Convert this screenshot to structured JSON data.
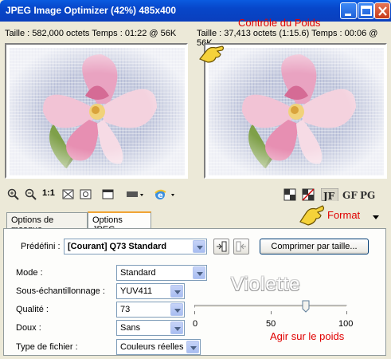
{
  "window": {
    "title": "JPEG Image Optimizer (42%) 485x400"
  },
  "info": {
    "left": "Taille : 582,000 octets Temps : 01:22 @ 56K",
    "right": "Taille : 37,413 octets (1:15.6) Temps : 00:06 @ 56K"
  },
  "annotations": {
    "weight_control": "Contrôle du Poids",
    "format": "Format",
    "act_on_weight": "Agir sur le poids",
    "watermark": "Violette"
  },
  "toolbar": {
    "zoom_reset_label": "1:1",
    "format_icons": [
      "jpeg-format-icon",
      "gif-format-icon",
      "png-format-icon"
    ]
  },
  "tabs": [
    {
      "label": "Options de masque",
      "active": false
    },
    {
      "label": "Options JPEG",
      "active": true
    }
  ],
  "form": {
    "preset_label": "Prédéfini :",
    "preset_value": "[Courant] Q73 Standard",
    "compress_button": "Comprimer par taille...",
    "mode_label": "Mode :",
    "mode_value": "Standard",
    "subsampling_label": "Sous-échantillonnage :",
    "subsampling_value": "YUV411",
    "quality_label": "Qualité :",
    "quality_value": "73",
    "smooth_label": "Doux :",
    "smooth_value": "Sans",
    "filetype_label": "Type de fichier :",
    "filetype_value": "Couleurs réelles"
  },
  "slider": {
    "min": "0",
    "mid": "50",
    "max": "100",
    "value": 73
  },
  "colors": {
    "title_bar": "#0a5be0",
    "annotation_red": "#e00000",
    "tab_accent": "#f0a434"
  }
}
